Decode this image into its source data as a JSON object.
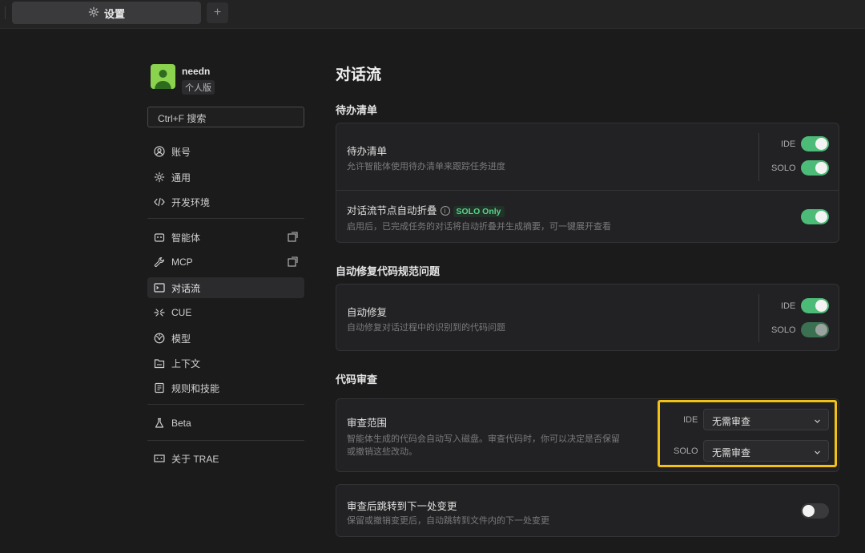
{
  "tabbar": {
    "active_tab": "设置",
    "new_tab": "+"
  },
  "sidebar": {
    "username": "needn",
    "plan": "个人版",
    "search_placeholder": "Ctrl+F 搜索",
    "items": [
      {
        "label": "账号",
        "icon": "account-circle-icon"
      },
      {
        "label": "通用",
        "icon": "gear-icon"
      },
      {
        "label": "开发环境",
        "icon": "code-icon"
      },
      {
        "label": "智能体",
        "icon": "agent-icon"
      },
      {
        "label": "MCP",
        "icon": "wrench-icon"
      },
      {
        "label": "对话流",
        "icon": "terminal-icon",
        "active": true
      },
      {
        "label": "CUE",
        "icon": "cue-icon"
      },
      {
        "label": "模型",
        "icon": "model-icon"
      },
      {
        "label": "上下文",
        "icon": "context-icon"
      },
      {
        "label": "规则和技能",
        "icon": "book-icon"
      },
      {
        "label": "Beta",
        "icon": "flask-icon"
      },
      {
        "label": "关于 TRAE",
        "icon": "trae-logo-icon"
      }
    ]
  },
  "main": {
    "title": "对话流",
    "todo": {
      "section": "待办清单",
      "row1": {
        "title": "待办清单",
        "desc": "允许智能体使用待办清单来跟踪任务进度",
        "ide_label": "IDE",
        "ide_on": true,
        "solo_label": "SOLO",
        "solo_on": true
      },
      "row2": {
        "title": "对话流节点自动折叠",
        "info": "i",
        "badge": "SOLO Only",
        "desc": "启用后，已完成任务的对话将自动折叠并生成摘要，可一键展开查看",
        "on": true
      }
    },
    "autofix": {
      "section": "自动修复代码规范问题",
      "row": {
        "title": "自动修复",
        "desc": "自动修复对话过程中的识别到的代码问题",
        "ide_label": "IDE",
        "ide_on": true,
        "solo_label": "SOLO",
        "solo_on": true
      }
    },
    "review": {
      "section": "代码审查",
      "row": {
        "title": "审查范围",
        "desc_line1": "智能体生成的代码会自动写入磁盘。审查代码时，你可以决定是否保留",
        "desc_line2": "或撤销这些改动。",
        "ide_label": "IDE",
        "ide_value": "无需审查",
        "solo_label": "SOLO",
        "solo_value": "无需审查"
      }
    },
    "jump": {
      "title": "审查后跳转到下一处变更",
      "desc": "保留或撤销变更后，自动跳转到文件内的下一处变更",
      "on": false
    }
  },
  "colors": {
    "accent_green": "#4dbb78",
    "highlight": "#f2c115",
    "background": "#1b1b1c"
  }
}
